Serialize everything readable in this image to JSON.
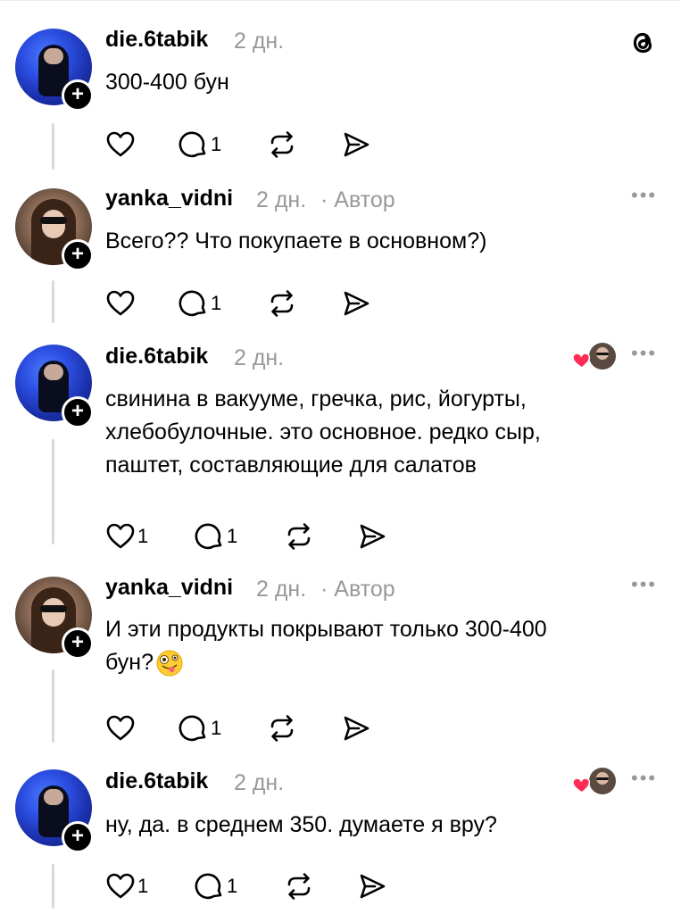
{
  "app": {
    "logo": "threads-logo-icon"
  },
  "comments": [
    {
      "username": "die.6tabik",
      "time": "2 дн.",
      "author_tag": "",
      "text": "300-400 бун",
      "likes": "",
      "replies": "1",
      "liked_by_author": false,
      "avatar": "blue-avatar"
    },
    {
      "username": "yanka_vidni",
      "time": "2 дн.",
      "author_tag": "· Автор",
      "text": "Всего?? Что покупаете в основном?)",
      "likes": "",
      "replies": "1",
      "liked_by_author": false,
      "avatar": "brown-avatar"
    },
    {
      "username": "die.6tabik",
      "time": "2 дн.",
      "author_tag": "",
      "text_lines": [
        "свинина в вакууме, гречка, рис, йогурты,",
        "хлебобулочные. это основное. редко сыр,",
        "паштет, составляющие для салатов"
      ],
      "likes": "1",
      "replies": "1",
      "liked_by_author": true,
      "avatar": "blue-avatar"
    },
    {
      "username": "yanka_vidni",
      "time": "2 дн.",
      "author_tag": "· Автор",
      "text_lines": [
        "И эти продукты покрывают только 300-400",
        "бун?"
      ],
      "emoji": "zany-face-emoji",
      "likes": "",
      "replies": "1",
      "liked_by_author": false,
      "avatar": "brown-avatar"
    },
    {
      "username": "die.6tabik",
      "time": "2 дн.",
      "author_tag": "",
      "text": "ну, да. в среднем 350. думаете я вру?",
      "likes": "1",
      "replies": "1",
      "liked_by_author": true,
      "avatar": "blue-avatar"
    }
  ]
}
